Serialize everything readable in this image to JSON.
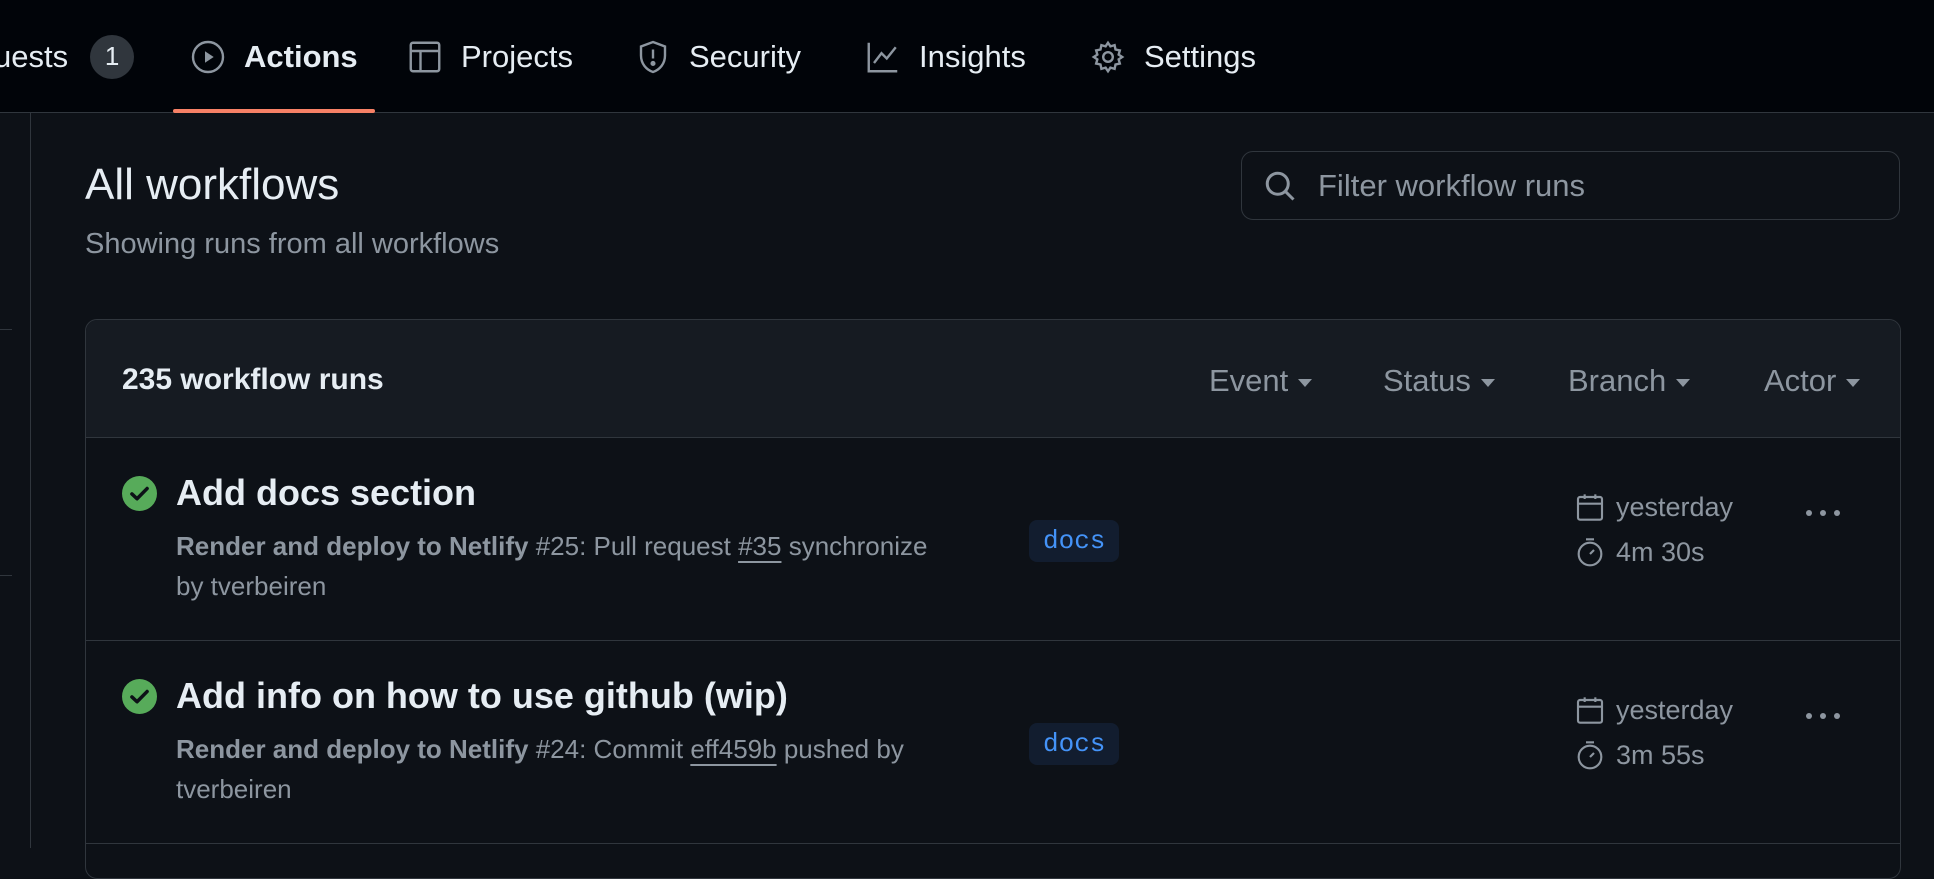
{
  "nav": {
    "tabs": [
      {
        "label": "uests",
        "counter": "1",
        "icon": "pull-request-icon"
      },
      {
        "label": "Actions",
        "icon": "play-icon",
        "active": true
      },
      {
        "label": "Projects",
        "icon": "table-icon"
      },
      {
        "label": "Security",
        "icon": "shield-icon"
      },
      {
        "label": "Insights",
        "icon": "graph-icon"
      },
      {
        "label": "Settings",
        "icon": "gear-icon"
      }
    ]
  },
  "header": {
    "title": "All workflows",
    "subtitle": "Showing runs from all workflows",
    "search_placeholder": "Filter workflow runs"
  },
  "runs_box": {
    "count_label": "235 workflow runs",
    "filters": [
      "Event",
      "Status",
      "Branch",
      "Actor"
    ]
  },
  "runs": [
    {
      "title": "Add docs section",
      "workflow": "Render and deploy to Netlify",
      "number_text": " #25: Pull request ",
      "ref": "#35",
      "after_ref": " synchronize",
      "actor_line": "by tverbeiren",
      "branch": "docs",
      "when": "yesterday",
      "duration": "4m 30s",
      "status": "success"
    },
    {
      "title": "Add info on how to use github (wip)",
      "workflow": "Render and deploy to Netlify",
      "number_text": " #24: Commit ",
      "ref": "eff459b",
      "after_ref": " pushed by",
      "actor_line": "tverbeiren",
      "branch": "docs",
      "when": "yesterday",
      "duration": "3m 55s",
      "status": "success"
    }
  ],
  "colors": {
    "background": "#0d1117",
    "nav_bg": "#010409",
    "accent_underline": "#f78166",
    "success": "#57ab5a",
    "branch_text": "#4493f8",
    "muted": "#8d96a0"
  }
}
